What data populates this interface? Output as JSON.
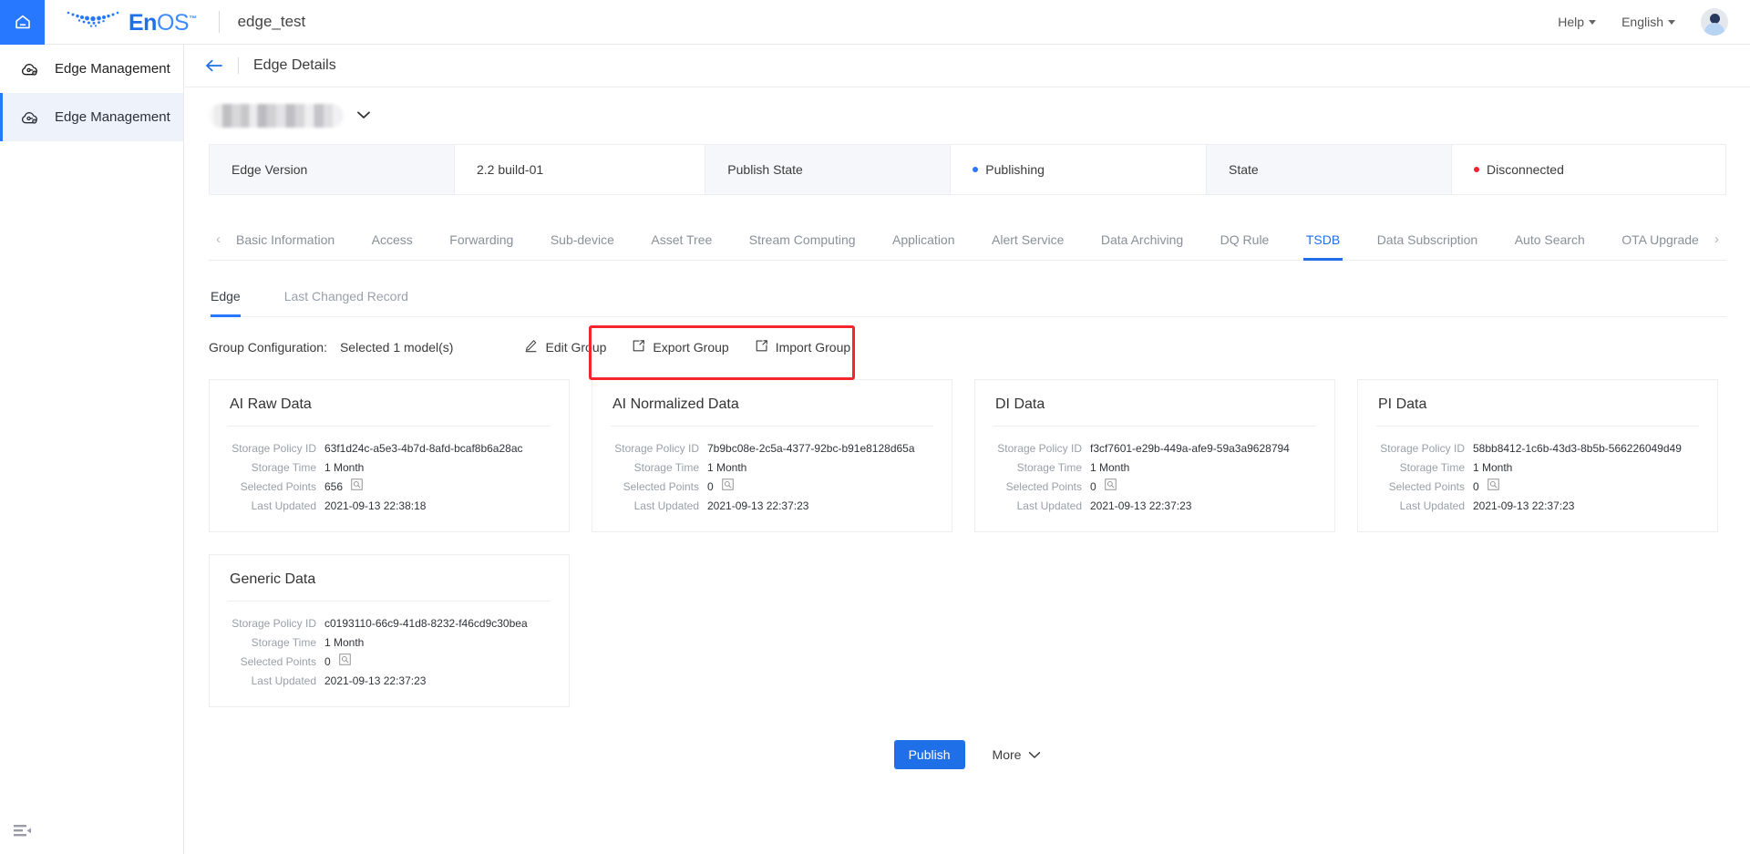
{
  "topbar": {
    "home_icon": "home-icon",
    "brand_en": "En",
    "brand_os": "OS",
    "brand_tm": "™",
    "app_title": "edge_test",
    "help_label": "Help",
    "language_label": "English",
    "avatar": "user-avatar"
  },
  "sidebar": {
    "items": [
      {
        "label": "Edge Management",
        "icon": "edge-cloud-icon",
        "active": false
      },
      {
        "label": "Edge Management",
        "icon": "edge-cloud-icon",
        "active": true
      }
    ],
    "collapse_icon": "sidebar-collapse-icon"
  },
  "page": {
    "back_icon": "back-arrow-icon",
    "title": "Edge Details",
    "device_name": "",
    "device_caret": "chevron-down-icon"
  },
  "info_strip": [
    {
      "key": "Edge Version",
      "value": "2.2 build-01",
      "dot": null
    },
    {
      "key": "Publish State",
      "value": "Publishing",
      "dot": "#2878ff"
    },
    {
      "key": "State",
      "value": "Disconnected",
      "dot": "#f5222d"
    }
  ],
  "tabs": {
    "prev_icon": "chevron-left-icon",
    "next_icon": "chevron-right-icon",
    "items": [
      {
        "label": "Basic Information",
        "active": false
      },
      {
        "label": "Access",
        "active": false
      },
      {
        "label": "Forwarding",
        "active": false
      },
      {
        "label": "Sub-device",
        "active": false
      },
      {
        "label": "Asset Tree",
        "active": false
      },
      {
        "label": "Stream Computing",
        "active": false
      },
      {
        "label": "Application",
        "active": false
      },
      {
        "label": "Alert Service",
        "active": false
      },
      {
        "label": "Data Archiving",
        "active": false
      },
      {
        "label": "DQ Rule",
        "active": false
      },
      {
        "label": "TSDB",
        "active": true
      },
      {
        "label": "Data Subscription",
        "active": false
      },
      {
        "label": "Auto Search",
        "active": false
      },
      {
        "label": "OTA Upgrade",
        "active": false
      }
    ]
  },
  "subtabs": [
    {
      "label": "Edge",
      "active": true
    },
    {
      "label": "Last Changed Record",
      "active": false
    }
  ],
  "group_config": {
    "label": "Group Configuration:",
    "selected_text": "Selected 1 model(s)",
    "actions": [
      {
        "label": "Edit Group",
        "icon": "pencil-icon"
      },
      {
        "label": "Export Group",
        "icon": "export-box-arrow-icon"
      },
      {
        "label": "Import Group",
        "icon": "import-box-arrow-icon"
      }
    ],
    "highlight_color": "#f5262b"
  },
  "field_labels": {
    "storage_policy_id": "Storage Policy ID",
    "storage_time": "Storage Time",
    "selected_points": "Selected Points",
    "last_updated": "Last Updated",
    "search_icon": "magnifier-icon"
  },
  "cards": [
    {
      "title": "AI Raw Data",
      "storage_policy_id": "63f1d24c-a5e3-4b7d-8afd-bcaf8b6a28ac",
      "storage_time": "1 Month",
      "selected_points": "656",
      "last_updated": "2021-09-13 22:38:18"
    },
    {
      "title": "AI Normalized Data",
      "storage_policy_id": "7b9bc08e-2c5a-4377-92bc-b91e8128d65a",
      "storage_time": "1 Month",
      "selected_points": "0",
      "last_updated": "2021-09-13 22:37:23"
    },
    {
      "title": "DI Data",
      "storage_policy_id": "f3cf7601-e29b-449a-afe9-59a3a9628794",
      "storage_time": "1 Month",
      "selected_points": "0",
      "last_updated": "2021-09-13 22:37:23"
    },
    {
      "title": "PI Data",
      "storage_policy_id": "58bb8412-1c6b-43d3-8b5b-566226049d49",
      "storage_time": "1 Month",
      "selected_points": "0",
      "last_updated": "2021-09-13 22:37:23"
    },
    {
      "title": "Generic Data",
      "storage_policy_id": "c0193110-66c9-41d8-8232-f46cd9c30bea",
      "storage_time": "1 Month",
      "selected_points": "0",
      "last_updated": "2021-09-13 22:37:23"
    }
  ],
  "footer": {
    "publish_label": "Publish",
    "more_label": "More",
    "more_icon": "chevron-down-icon",
    "publish_color": "#1f6fe8"
  }
}
